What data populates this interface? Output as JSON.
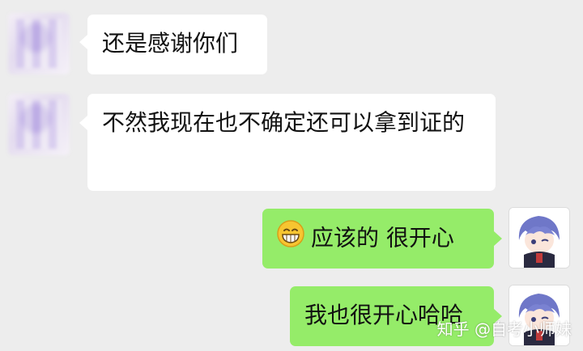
{
  "messages": [
    {
      "side": "in",
      "text": "还是感谢你们"
    },
    {
      "side": "in",
      "text": "不然我现在也不确定还可以拿到证的"
    },
    {
      "side": "out",
      "emoji": "grinning-face-emoji",
      "text": "应该的 很开心"
    },
    {
      "side": "out",
      "text": "我也很开心哈哈"
    }
  ],
  "watermark": "知乎 @自考小师妹",
  "colors": {
    "background": "#ededed",
    "incoming_bubble": "#ffffff",
    "outgoing_bubble": "#95ec69",
    "text": "#111111"
  }
}
